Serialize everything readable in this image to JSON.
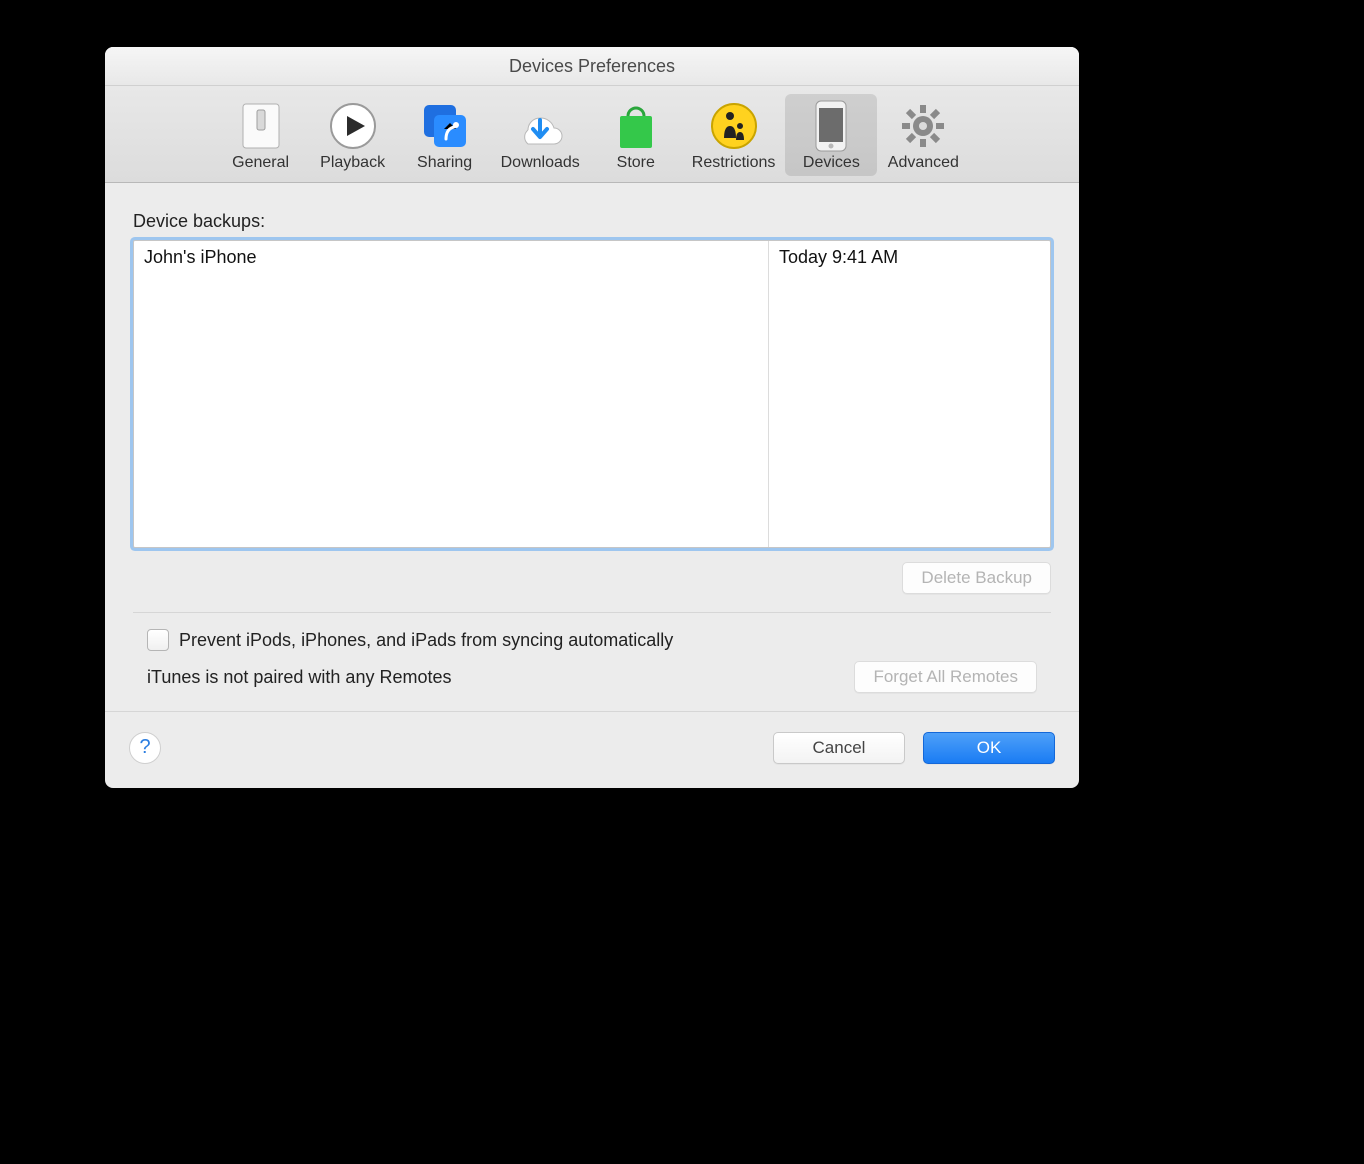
{
  "window": {
    "title": "Devices Preferences"
  },
  "tabs": [
    {
      "label": "General"
    },
    {
      "label": "Playback"
    },
    {
      "label": "Sharing"
    },
    {
      "label": "Downloads"
    },
    {
      "label": "Store"
    },
    {
      "label": "Restrictions"
    },
    {
      "label": "Devices",
      "active": true
    },
    {
      "label": "Advanced"
    }
  ],
  "device_backups": {
    "section_label": "Device backups:",
    "rows": [
      {
        "name": "John's iPhone",
        "date": "Today 9:41 AM"
      }
    ]
  },
  "buttons": {
    "delete_backup": "Delete Backup",
    "forget_remotes": "Forget All Remotes",
    "cancel": "Cancel",
    "ok": "OK",
    "help": "?"
  },
  "options": {
    "prevent_sync_label": "Prevent iPods, iPhones, and iPads from syncing automatically",
    "prevent_sync_checked": false,
    "remotes_status": "iTunes is not paired with any Remotes"
  }
}
